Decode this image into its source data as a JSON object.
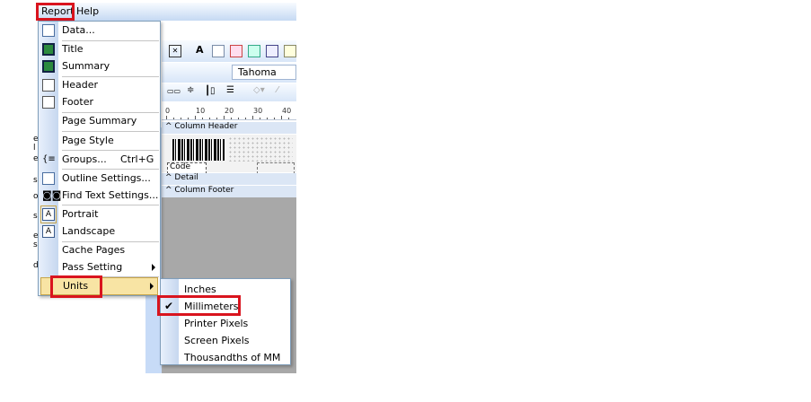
{
  "menubar": {
    "report": "Report",
    "help": "Help"
  },
  "font_box": "Tahoma",
  "ruler": [
    "0",
    "10",
    "20",
    "30",
    "40"
  ],
  "bands": {
    "column_header": "^ Column Header",
    "detail": "^ Detail",
    "column_footer": "^ Column Footer"
  },
  "code_field": "Code",
  "report_menu": {
    "items": [
      {
        "label": "Data...",
        "icon": "database-icon"
      },
      {
        "label": "Title",
        "icon": "title-section-icon"
      },
      {
        "label": "Summary",
        "icon": "summary-section-icon"
      },
      {
        "label": "Header",
        "icon": "page-header-icon"
      },
      {
        "label": "Footer",
        "icon": "page-footer-icon"
      },
      {
        "label": "Page Summary"
      },
      {
        "label": "Page Style"
      },
      {
        "label": "Groups...",
        "shortcut": "Ctrl+G",
        "icon": "groups-icon"
      },
      {
        "label": "Outline Settings...",
        "icon": "outline-icon"
      },
      {
        "label": "Find Text Settings...",
        "icon": "binoculars-icon"
      },
      {
        "label": "Portrait",
        "icon": "portrait-icon"
      },
      {
        "label": "Landscape",
        "icon": "landscape-icon"
      },
      {
        "label": "Cache Pages"
      },
      {
        "label": "Pass Setting"
      },
      {
        "label": "Units"
      }
    ]
  },
  "units_menu": {
    "items": [
      {
        "label": "Inches"
      },
      {
        "label": "Millimeters",
        "checked": true
      },
      {
        "label": "Printer Pixels"
      },
      {
        "label": "Screen Pixels"
      },
      {
        "label": "Thousandths of MM"
      }
    ],
    "check_mark": "✔"
  },
  "left_artifacts": [
    "e",
    "l",
    "e",
    "s",
    "o",
    "s",
    "e",
    "s",
    "d"
  ],
  "colors": {
    "highlight_box": "#d9141e",
    "menu_hover": "#f8e4a4",
    "menu_gutter": "#c6d7ef"
  }
}
